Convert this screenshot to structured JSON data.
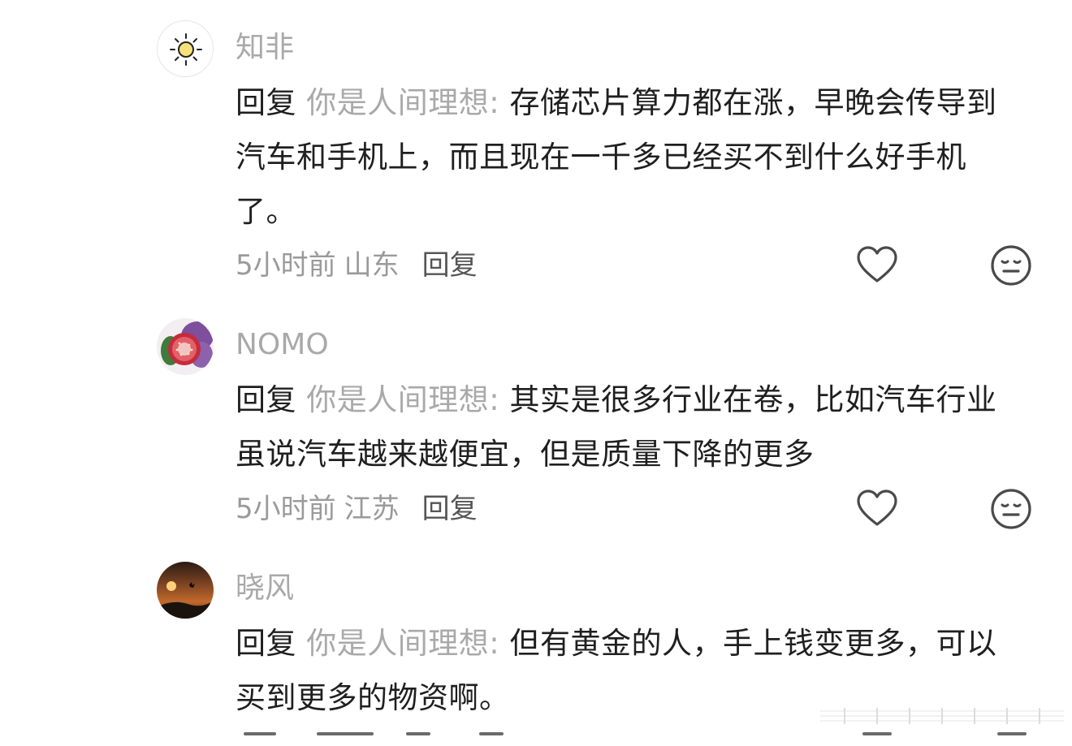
{
  "comments": [
    {
      "username": "知非",
      "reply_prefix": "回复 ",
      "reply_target": "你是人间理想",
      "reply_sep": ": ",
      "text": "存储芯片算力都在涨，早晚会传导到汽车和手机上，而且现在一千多已经买不到什么好手机了。",
      "time": "5小时前",
      "location": "山东",
      "reply_label": "回复",
      "avatar_icon": "sun-icon"
    },
    {
      "username": "NOMO",
      "reply_prefix": "回复 ",
      "reply_target": "你是人间理想",
      "reply_sep": ": ",
      "text": "其实是很多行业在卷，比如汽车行业 虽说汽车越来越便宜，但是质量下降的更多",
      "time": "5小时前",
      "location": "江苏",
      "reply_label": "回复",
      "avatar_icon": "fig-icon"
    },
    {
      "username": "晓风",
      "reply_prefix": "回复 ",
      "reply_target": "你是人间理想",
      "reply_sep": ": ",
      "text": "但有黄金的人，手上钱变更多，可以买到更多的物资啊。",
      "avatar_icon": "sunset-icon"
    }
  ],
  "icons": {
    "like": "heart-icon",
    "dislike": "neutral-face-icon"
  },
  "colors": {
    "text": "#1f1f1f",
    "muted": "#a9a9a9",
    "icon": "#4a4a4a"
  }
}
